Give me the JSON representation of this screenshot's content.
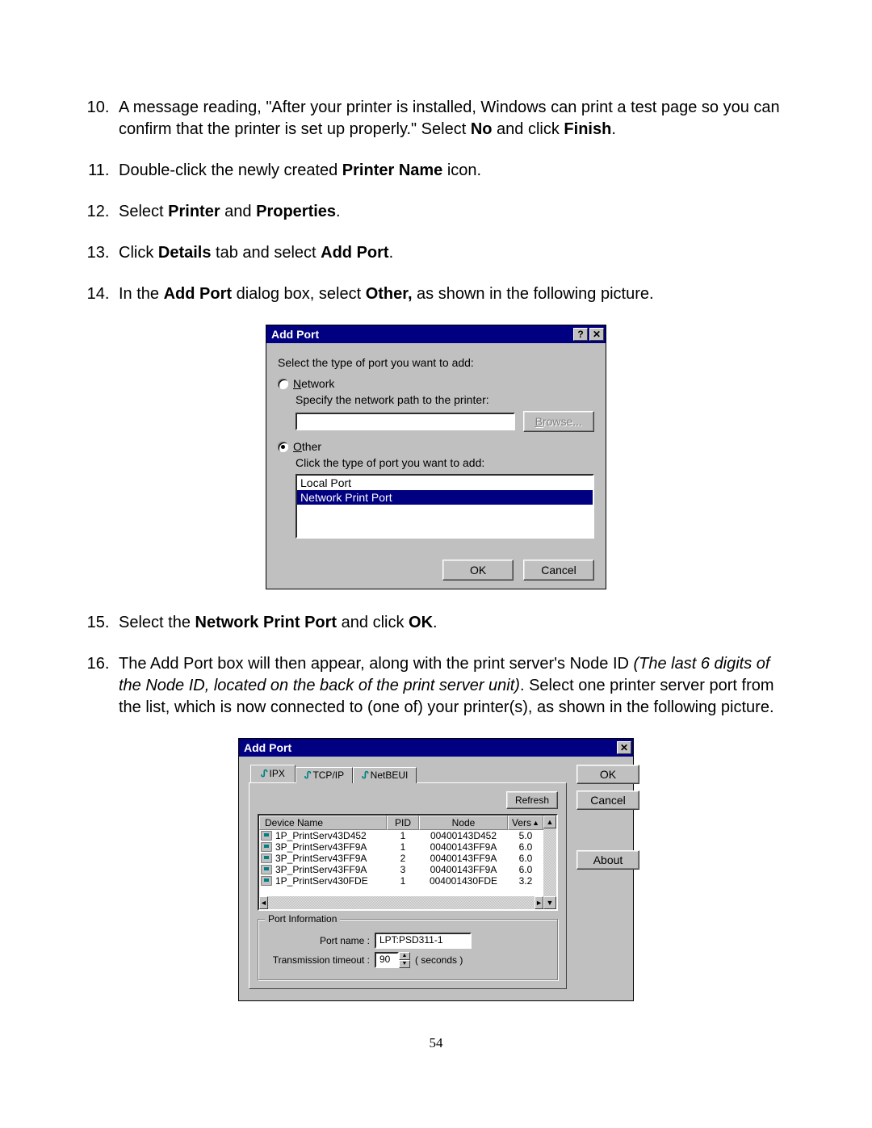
{
  "steps": {
    "s10": {
      "num": "10.",
      "text_a": "A message reading, \"After your printer is installed, Windows can print a test page so you can confirm that the printer is set up properly.\" Select ",
      "b1": "No",
      "text_b": " and click ",
      "b2": "Finish",
      "text_c": "."
    },
    "s11": {
      "num": "11.",
      "text_a": "Double-click the newly created ",
      "b1": "Printer Name",
      "text_b": " icon."
    },
    "s12": {
      "num": "12.",
      "text_a": "Select ",
      "b1": "Printer",
      "text_b": " and ",
      "b2": "Properties",
      "text_c": "."
    },
    "s13": {
      "num": "13.",
      "text_a": "Click ",
      "b1": "Details",
      "text_b": " tab and select ",
      "b2": "Add Port",
      "text_c": "."
    },
    "s14": {
      "num": "14.",
      "text_a": "In the ",
      "b1": "Add Port",
      "text_b": " dialog box, select ",
      "b2": "Other,",
      "text_c": " as shown in the following picture."
    },
    "s15": {
      "num": "15.",
      "text_a": "Select the ",
      "b1": "Network Print Port",
      "text_b": " and click ",
      "b2": "OK",
      "text_c": "."
    },
    "s16": {
      "num": "16.",
      "text_a": "The Add Port box will then appear, along with the print server's Node ID ",
      "i1": "(The last 6 digits of the Node ID, located on the back of the print server unit)",
      "text_b": ". Select one printer server port from the list, which is now connected to (one of) your printer(s), as shown in the following picture."
    }
  },
  "dialog1": {
    "title": "Add Port",
    "help": "?",
    "close": "✕",
    "intro": "Select the type of port you want to add:",
    "radio_network": "Network",
    "network_sub": "Specify the network path to the printer:",
    "browse": "Browse...",
    "radio_other": "Other",
    "other_sub": "Click the type of port you want to add:",
    "list_item1": "Local Port",
    "list_item2": "Network Print Port",
    "ok": "OK",
    "cancel": "Cancel"
  },
  "dialog2": {
    "title": "Add Port",
    "close": "✕",
    "tab1": "IPX",
    "tab2": "TCP/IP",
    "tab3": "NetBEUI",
    "ok": "OK",
    "cancel": "Cancel",
    "about": "About",
    "refresh": "Refresh",
    "headers": {
      "dev": "Device Name",
      "pid": "PID",
      "node": "Node",
      "vers": "Vers"
    },
    "rows": [
      {
        "dev": "1P_PrintServ43D452",
        "pid": "1",
        "node": "00400143D452",
        "vers": "5.0"
      },
      {
        "dev": "3P_PrintServ43FF9A",
        "pid": "1",
        "node": "00400143FF9A",
        "vers": "6.0"
      },
      {
        "dev": "3P_PrintServ43FF9A",
        "pid": "2",
        "node": "00400143FF9A",
        "vers": "6.0"
      },
      {
        "dev": "3P_PrintServ43FF9A",
        "pid": "3",
        "node": "00400143FF9A",
        "vers": "6.0"
      },
      {
        "dev": "1P_PrintServ430FDE",
        "pid": "1",
        "node": "004001430FDE",
        "vers": "3.2"
      }
    ],
    "group": "Port Information",
    "portname_label": "Port name :",
    "portname_value": "LPT:PSD311-1",
    "timeout_label": "Transmission timeout :",
    "timeout_value": "90",
    "timeout_unit": "( seconds )"
  },
  "page_number": "54"
}
